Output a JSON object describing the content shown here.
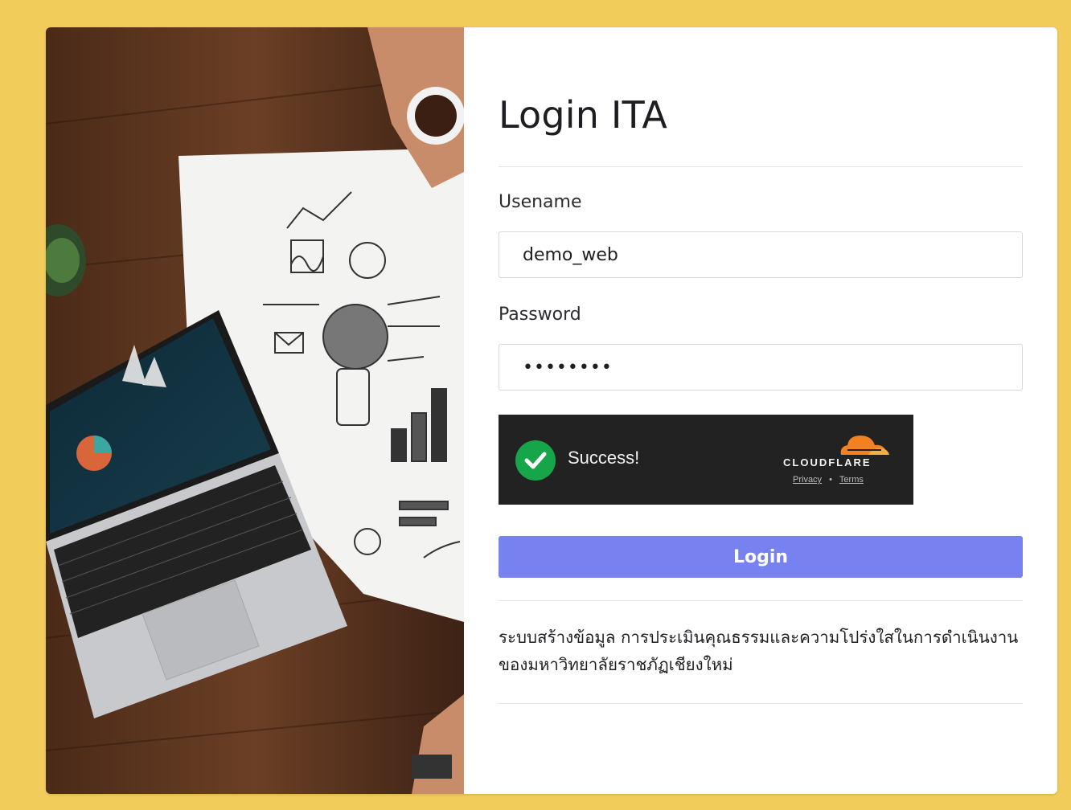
{
  "page": {
    "background_color": "#f2cc5a",
    "card_color": "#ffffff"
  },
  "form": {
    "title": "Login ITA",
    "username_label": "Usename",
    "username_value": "demo_web",
    "password_label": "Password",
    "password_value": "12345678",
    "login_button": "Login",
    "button_color": "#7781f0"
  },
  "captcha": {
    "status": "Success!",
    "brand": "CLOUDFLARE",
    "privacy_link": "Privacy",
    "separator": "•",
    "terms_link": "Terms",
    "icon": "check-circle-icon",
    "brand_icon": "cloudflare-cloud-icon"
  },
  "description": "ระบบสร้างข้อมูล การประเมินคุณธรรมและความโปร่งใสในการดำเนินงานของมหาวิทยาลัยราชภัฏเชียงใหม่"
}
